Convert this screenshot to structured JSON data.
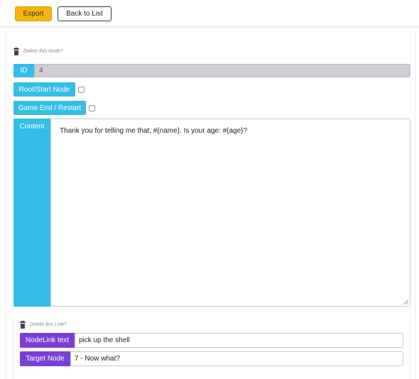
{
  "toolbar": {
    "export_label": "Export",
    "back_label": "Back to List"
  },
  "node": {
    "delete_label": "Delete this Node?",
    "id_label": "ID",
    "id_value": "4",
    "root_label": "Root/Start Node",
    "root_checked": false,
    "game_end_label": "Game End / Restart",
    "game_end_checked": false,
    "content_label": "Content",
    "content_value": "Thank you for telling me that, #{name}. Is your age: #{age}?"
  },
  "link": {
    "delete_label": "Delete this Link?",
    "text_label": "NodeLink text",
    "text_value": "pick up the shell",
    "target_label": "Target Node",
    "target_value": "7 - Now what?"
  },
  "colors": {
    "export_button": "#f6b40e",
    "node_label": "#35bdea",
    "link_label": "#7c3fd6",
    "readonly_field": "#ccced3"
  },
  "icons": {
    "delete_node": "trash-icon",
    "delete_link": "trash-icon"
  }
}
